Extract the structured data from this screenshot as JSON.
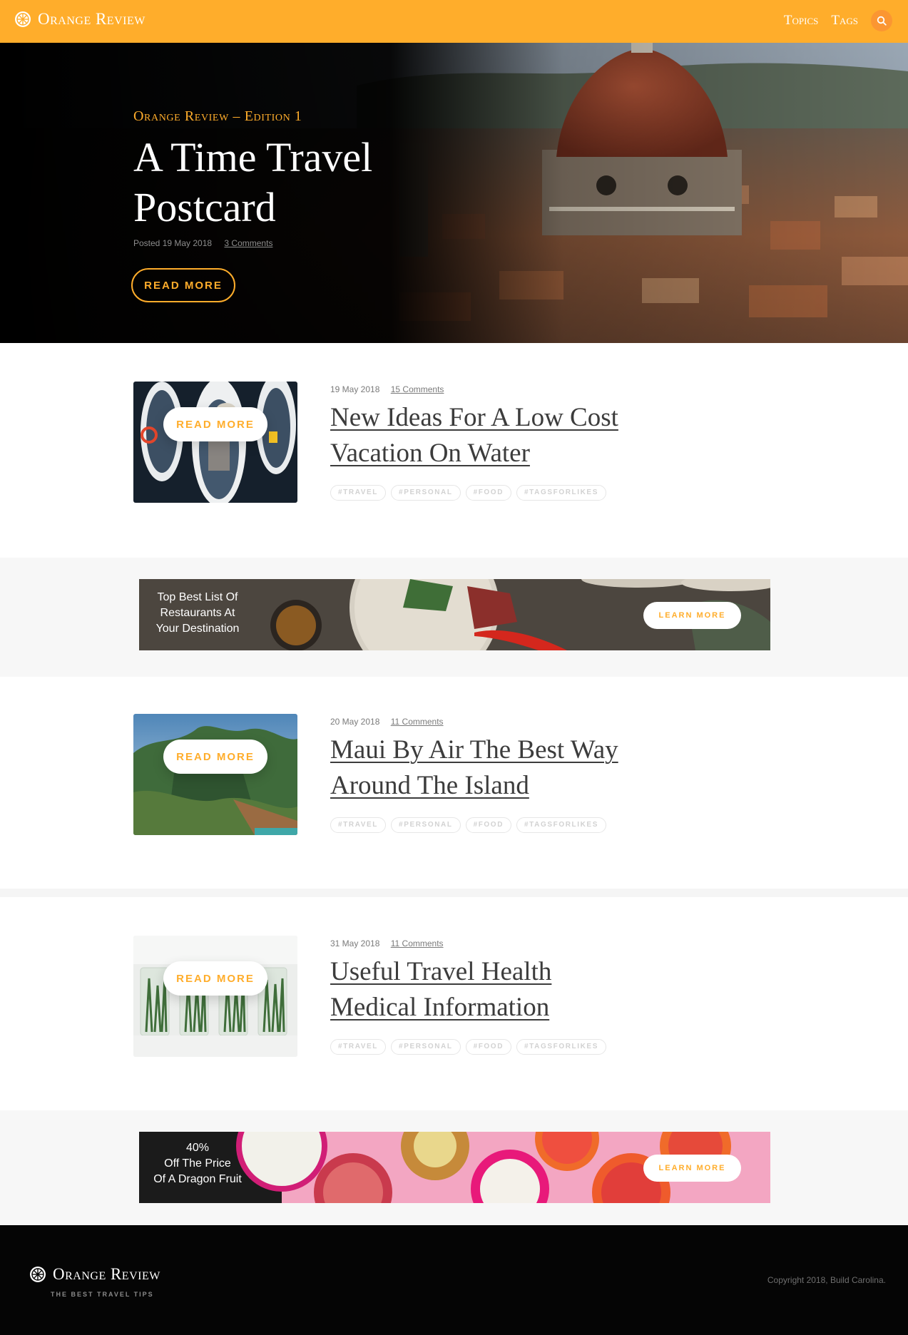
{
  "header": {
    "brand": "Orange Review",
    "nav": [
      "Topics",
      "Tags"
    ],
    "search_icon": "search-icon"
  },
  "hero": {
    "edition": "Orange Review – Edition 1",
    "title": "A Time Travel Postcard",
    "posted": "Posted 19 May 2018",
    "comments": "3 Comments",
    "button": "READ MORE"
  },
  "posts": [
    {
      "date": "19 May 2018",
      "comments": "15 Comments",
      "title": "New Ideas For A Low Cost Vacation On Water",
      "button": "READ MORE",
      "tags": [
        "#TRAVEL",
        "#PERSONAL",
        "#FOOD",
        "#TAGSFORLIKES"
      ]
    },
    {
      "date": "20 May 2018",
      "comments": "11 Comments",
      "title": "Maui By Air The Best Way Around The Island",
      "button": "READ MORE",
      "tags": [
        "#TRAVEL",
        "#PERSONAL",
        "#FOOD",
        "#TAGSFORLIKES"
      ]
    },
    {
      "date": "31 May 2018",
      "comments": "11 Comments",
      "title": "Useful Travel Health Medical Information",
      "button": "READ MORE",
      "tags": [
        "#TRAVEL",
        "#PERSONAL",
        "#FOOD",
        "#TAGSFORLIKES"
      ]
    }
  ],
  "ads": [
    {
      "text": "Top Best List Of Restaurants At Your Destination",
      "button": "LEARN MORE"
    },
    {
      "text_line1": "40%",
      "text_line2": "Off The Price",
      "text_line3": "Of A Dragon Fruit",
      "button": "LEARN MORE"
    }
  ],
  "footer": {
    "brand": "Orange Review",
    "tagline": "THE BEST TRAVEL TIPS",
    "copyright": "Copyright 2018, Build Carolina."
  },
  "colors": {
    "accent": "#ffad2b",
    "search_bg": "#fb9632",
    "footer_bg": "#050505"
  }
}
